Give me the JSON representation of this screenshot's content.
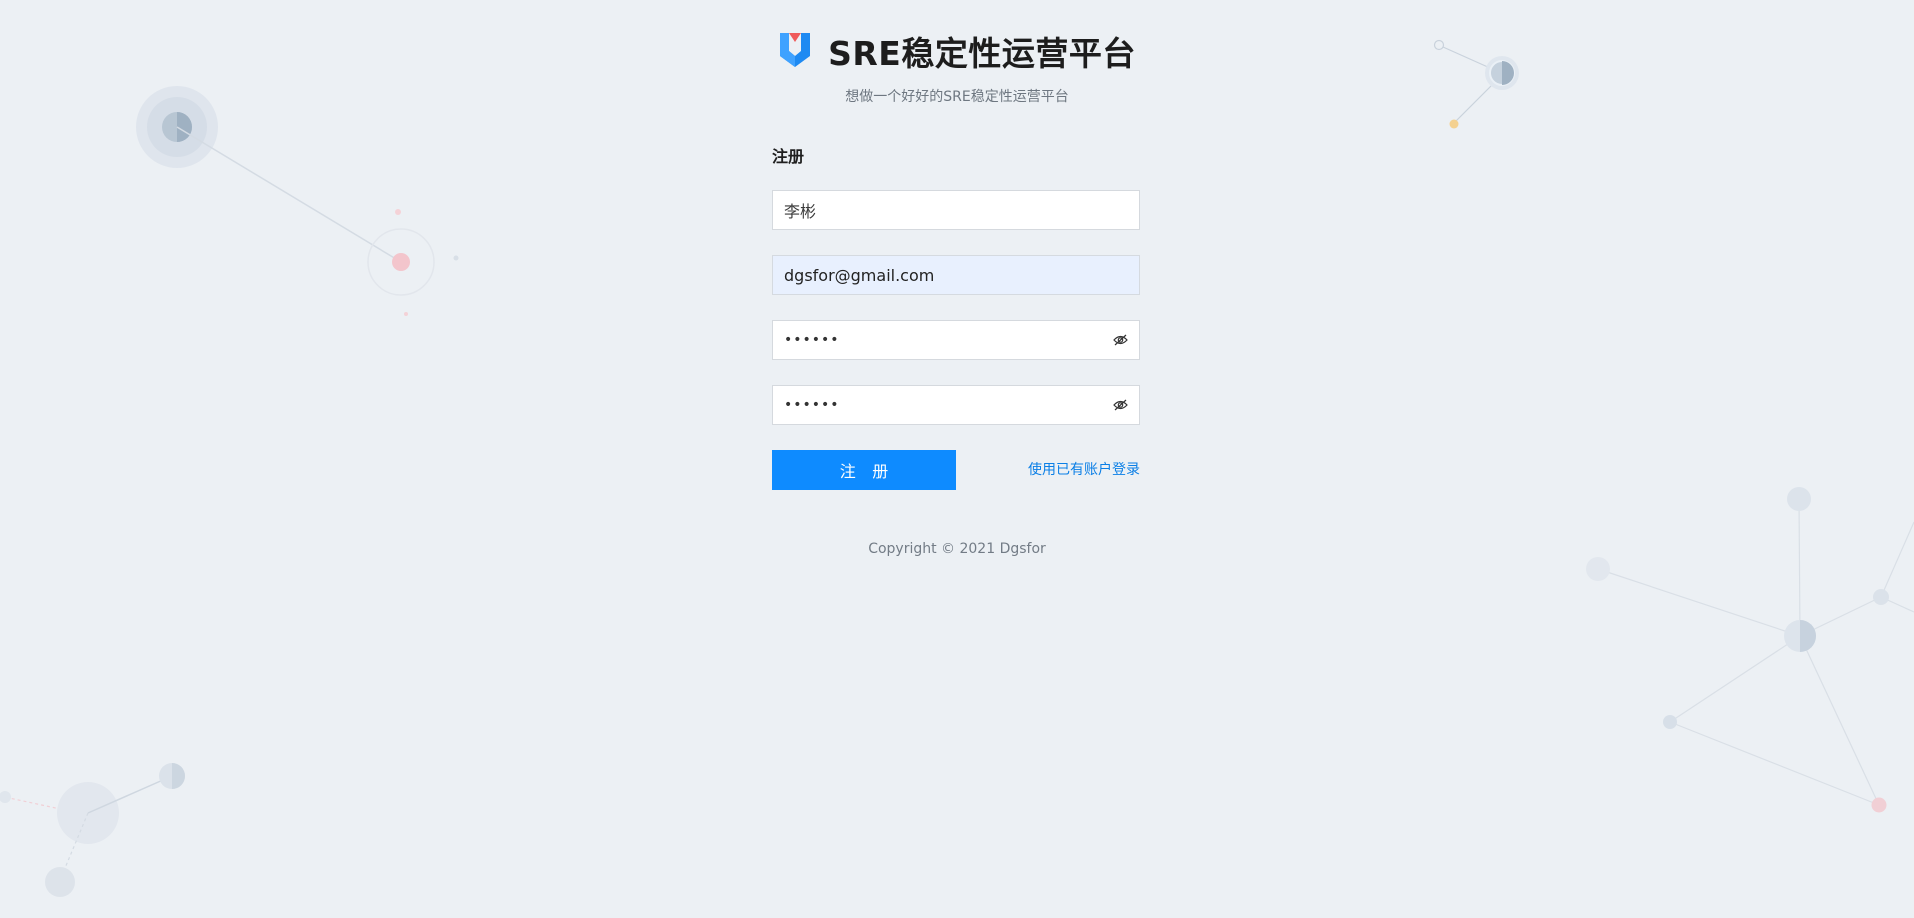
{
  "header": {
    "title": "SRE稳定性运营平台",
    "subtitle": "想做一个好好的SRE稳定性运营平台",
    "logo_icon": "v-shield-logo-icon"
  },
  "form": {
    "title": "注册",
    "username_value": "李彬",
    "email_value": "dgsfor@gmail.com",
    "password_masked": "••••••",
    "confirm_password_masked": "••••••",
    "toggle_icon": "eye-off-icon",
    "submit_label": "注 册",
    "login_link": "使用已有账户登录"
  },
  "footer": {
    "copyright": "Copyright © 2021 Dgsfor"
  },
  "colors": {
    "background": "#ecf0f4",
    "primary": "#0e8bff",
    "link": "#0b7fe6",
    "autofill": "#e8f0fe"
  }
}
